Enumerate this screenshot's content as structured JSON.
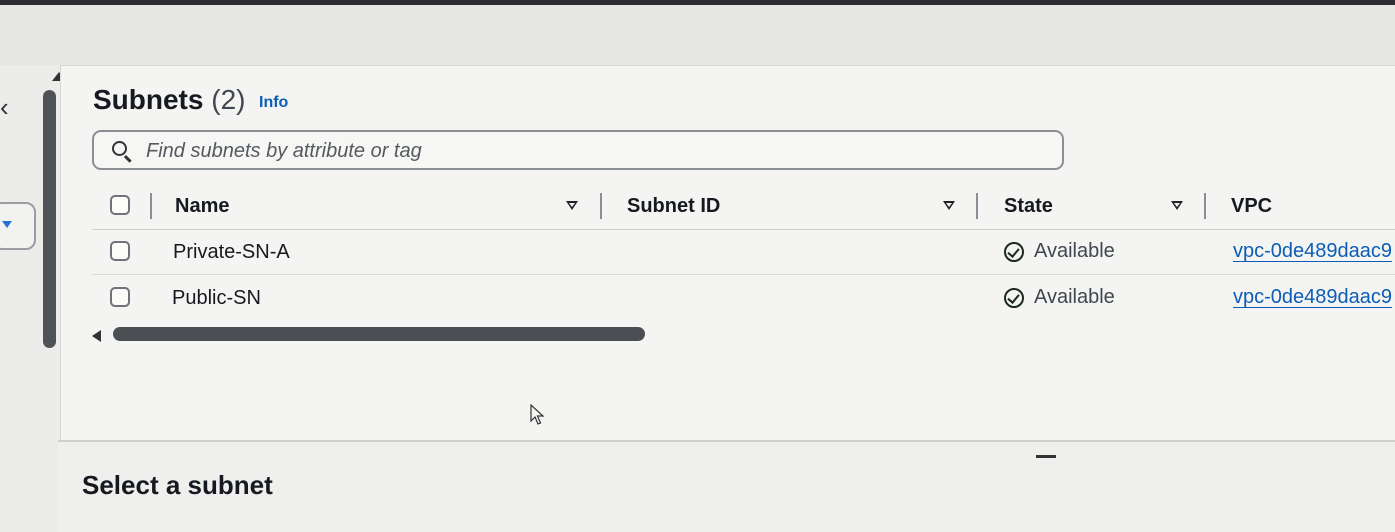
{
  "header": {
    "title": "Subnets",
    "count": "(2)",
    "info_label": "Info"
  },
  "search": {
    "placeholder": "Find subnets by attribute or tag"
  },
  "table": {
    "columns": [
      {
        "label": "Name"
      },
      {
        "label": "Subnet ID"
      },
      {
        "label": "State"
      },
      {
        "label": "VPC"
      }
    ],
    "rows": [
      {
        "name": "Private-SN-A",
        "subnet_id": "",
        "state": "Available",
        "vpc": "vpc-0de489daac9"
      },
      {
        "name": "Public-SN",
        "subnet_id": "",
        "state": "Available",
        "vpc": "vpc-0de489daac9"
      }
    ]
  },
  "details": {
    "title": "Select a subnet"
  },
  "icons": {
    "back": "chevron-left-icon",
    "search": "search-icon",
    "sort": "sort-down-icon",
    "state": "check-circle-icon",
    "cursor": "mouse-pointer-icon"
  },
  "colors": {
    "link": "#0b5db6",
    "text": "#16191f"
  }
}
